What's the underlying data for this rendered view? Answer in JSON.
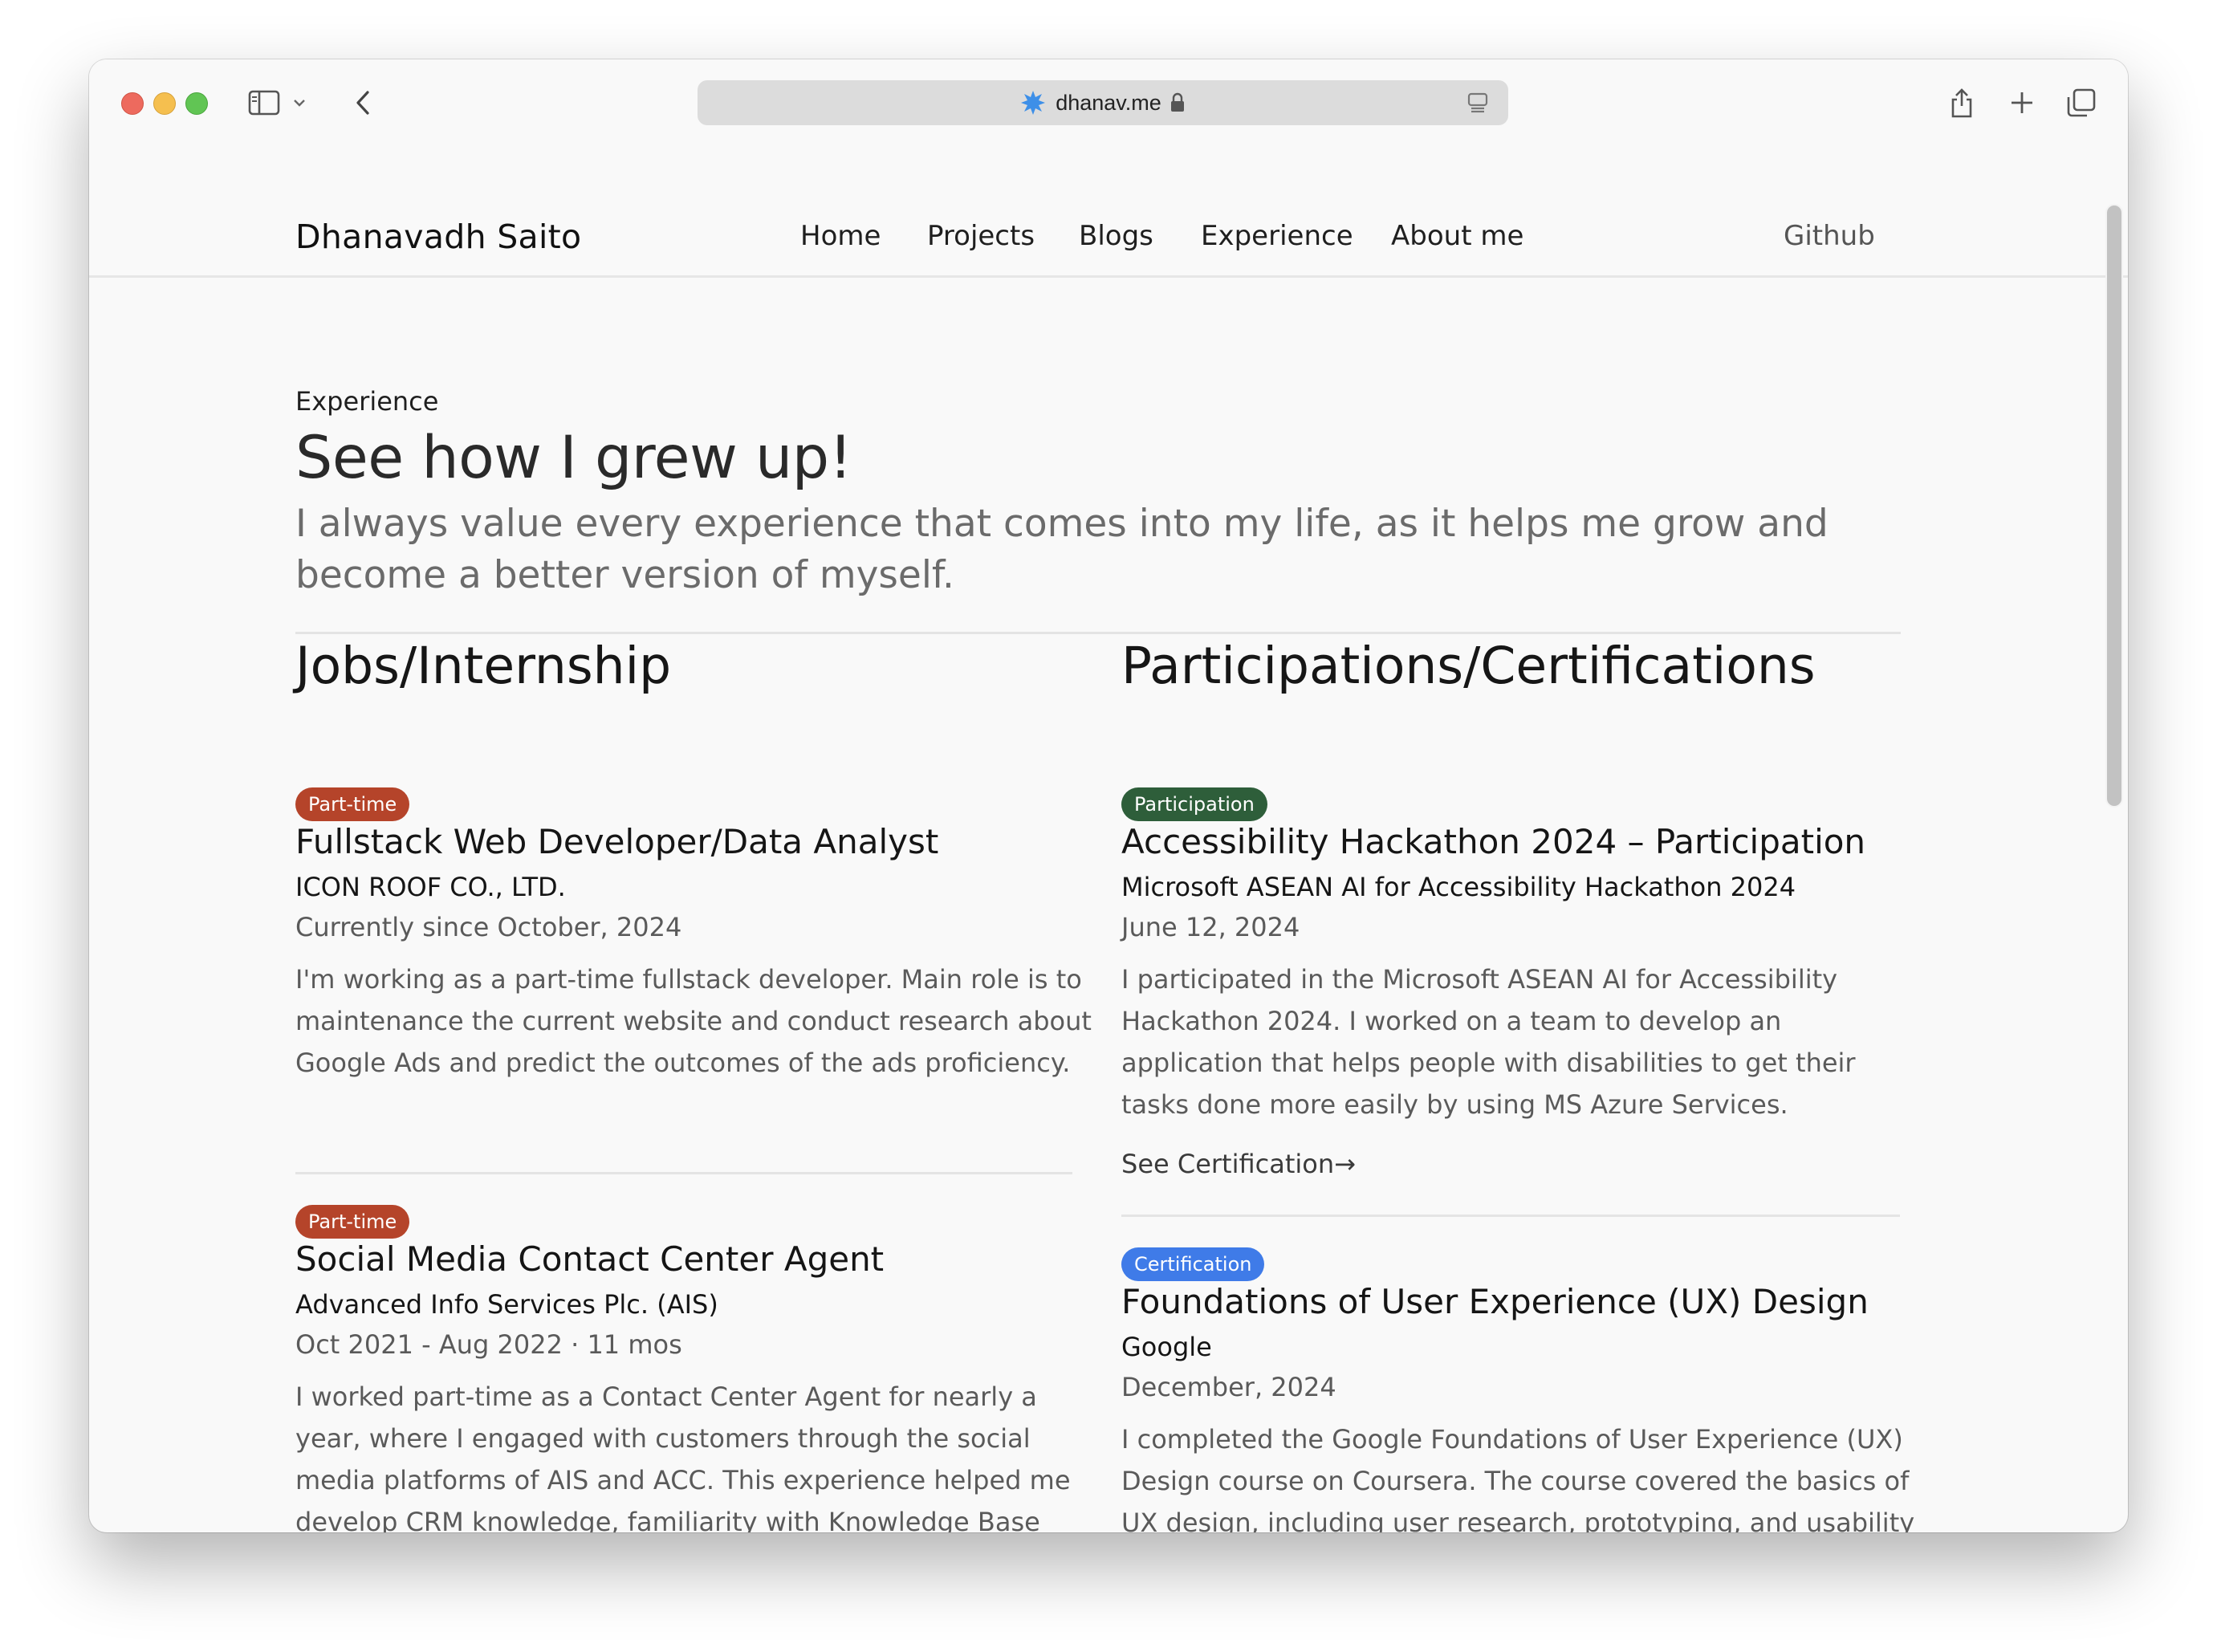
{
  "browser": {
    "url": "dhanav.me",
    "icons": {
      "close": "close-dot",
      "minimize": "minimize-dot",
      "zoom": "zoom-dot",
      "sidebar": "sidebar-icon",
      "chevron": "chevron-down-icon",
      "back": "back-icon",
      "share": "share-icon",
      "newtab": "plus-icon",
      "tabs": "tab-overview-icon"
    }
  },
  "site": {
    "brand": "Dhanavadh Saito",
    "nav": {
      "home": "Home",
      "projects": "Projects",
      "blogs": "Blogs",
      "experience": "Experience",
      "about": "About me"
    },
    "github": "Github"
  },
  "hero": {
    "eyebrow": "Experience",
    "title": "See how I grew up!",
    "subtitle": "I always value every experience that comes into my life, as it helps me grow and become a better version of myself."
  },
  "jobs": {
    "heading": "Jobs/Internship",
    "items": [
      {
        "badge": "Part-time",
        "role": "Fullstack Web Developer/Data Analyst",
        "org": "ICON ROOF CO., LTD.",
        "date": "Currently since October, 2024",
        "desc": "I'm working as a part-time fullstack developer. Main role is to maintenance the current website and conduct research about Google Ads and predict the outcomes of the ads proficiency."
      },
      {
        "badge": "Part-time",
        "role": "Social Media Contact Center Agent",
        "org": "Advanced Info Services Plc. (AIS)",
        "date": "Oct 2021 - Aug 2022 · 11 mos",
        "desc": "I worked part-time as a Contact Center Agent for nearly a year, where I engaged with customers through the social media platforms of AIS and ACC. This experience helped me develop CRM knowledge, familiarity with Knowledge Base systems, and significantly enhanced my communication"
      }
    ]
  },
  "participations": {
    "heading": "Participations/Certifications",
    "items": [
      {
        "badge": "Participation",
        "role": "Accessibility Hackathon 2024 – Participation",
        "org": "Microsoft ASEAN AI for Accessibility Hackathon 2024",
        "date": "June 12, 2024",
        "desc": "I participated in the Microsoft ASEAN AI for Accessibility Hackathon 2024. I worked on a team to develop an application that helps people with disabilities to get their tasks done more easily by using MS Azure Services.",
        "link": "See Certification→"
      },
      {
        "badge": "Certification",
        "role": "Foundations of User Experience (UX) Design",
        "org": "Google",
        "date": "December, 2024",
        "desc": "I completed the Google Foundations of User Experience (UX) Design course on Coursera. The course covered the basics of UX design, including user research, prototyping, and usability testing."
      }
    ]
  },
  "colors": {
    "badge_parttime": "#b5442a",
    "badge_participation": "#2e5e3a",
    "badge_certification": "#3f7be8"
  }
}
